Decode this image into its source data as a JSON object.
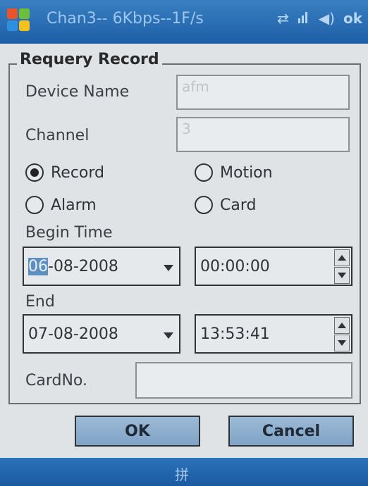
{
  "titlebar": {
    "title": "Chan3-- 6Kbps--1F/s",
    "ok_label": "ok"
  },
  "form": {
    "group_title": "Requery Record",
    "device_name_label": "Device Name",
    "device_name_value": "afm",
    "channel_label": "Channel",
    "channel_value": "3",
    "radios": {
      "record": "Record",
      "motion": "Motion",
      "alarm": "Alarm",
      "card": "Card"
    },
    "begin_time_label": "Begin Time",
    "begin_date_sel": "06",
    "begin_date_rest": "-08-2008",
    "begin_time_value": "00:00:00",
    "end_label": "End",
    "end_date_value": "07-08-2008",
    "end_time_value": "13:53:41",
    "card_no_label": "CardNo.",
    "card_no_value": ""
  },
  "buttons": {
    "ok": "OK",
    "cancel": "Cancel"
  },
  "bottombar": {
    "ime_glyph": "拼"
  },
  "colors": {
    "titlebar": "#1d5fa6",
    "button": "#8fb0d0",
    "selection": "#5e8fc0"
  }
}
